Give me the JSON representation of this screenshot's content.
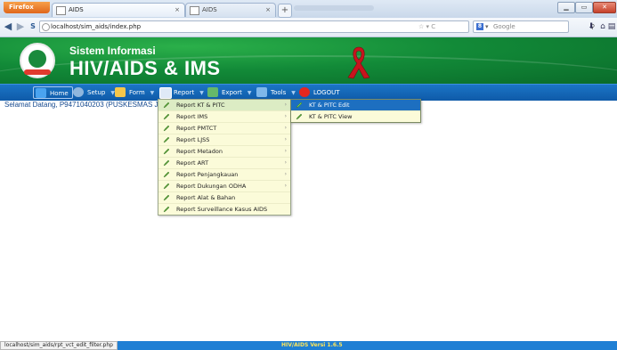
{
  "browser": {
    "app_button": "Firefox",
    "tabs": [
      {
        "title": "AIDS",
        "active": true
      },
      {
        "title": "AIDS",
        "active": false
      }
    ],
    "url": "localhost/sim_aids/index.php",
    "search_placeholder": "Google",
    "search_engine_letter": "8"
  },
  "site": {
    "title_line1": "Sistem Informasi",
    "title_line2": "HIV/AIDS & IMS"
  },
  "menu": {
    "items": [
      {
        "label": "Home"
      },
      {
        "label": "Setup"
      },
      {
        "label": "Form"
      },
      {
        "label": "Report"
      },
      {
        "label": "Export"
      },
      {
        "label": "Tools"
      },
      {
        "label": "LOGOUT"
      }
    ]
  },
  "welcome_text": "Selamat Datang, P9471040203 (PUSKESMAS JA",
  "report_menu": {
    "items": [
      {
        "label": "Report KT & PITC",
        "has_sub": true
      },
      {
        "label": "Report IMS",
        "has_sub": true
      },
      {
        "label": "Report PMTCT",
        "has_sub": true
      },
      {
        "label": "Report LJSS",
        "has_sub": true
      },
      {
        "label": "Report Metadon",
        "has_sub": true
      },
      {
        "label": "Report ART",
        "has_sub": true
      },
      {
        "label": "Report Penjangkauan",
        "has_sub": true
      },
      {
        "label": "Report Dukungan ODHA",
        "has_sub": true
      },
      {
        "label": "Report Alat & Bahan",
        "has_sub": false
      },
      {
        "label": "Report Surveillance Kasus AIDS",
        "has_sub": false
      }
    ]
  },
  "submenu": {
    "items": [
      {
        "label": "KT & PITC Edit",
        "highlighted": true
      },
      {
        "label": "KT & PITC View",
        "highlighted": false
      }
    ]
  },
  "statusbar": {
    "link": "localhost/sim_aids/rpt_vct_edit_filter.php",
    "version": "HIV/AIDS Versi 1.6.5"
  },
  "colors": {
    "banner_green": "#128a38",
    "menubar_blue": "#1b75c6",
    "dropdown_bg": "#fbfbd9",
    "highlight_blue": "#1d6fc0",
    "ribbon_red": "#c8141e"
  }
}
